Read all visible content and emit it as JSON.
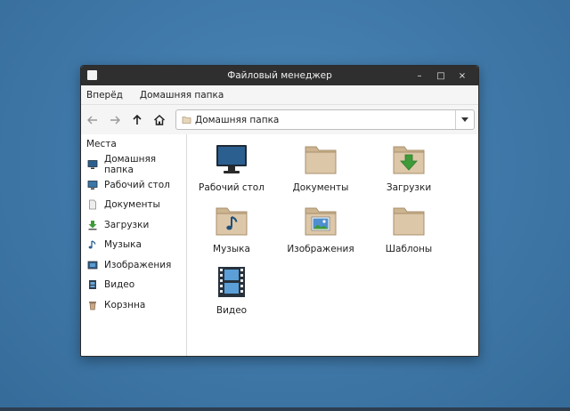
{
  "window": {
    "title": "Файловый менеджер",
    "controls": {
      "minimize": "–",
      "maximize": "□",
      "close": "×"
    }
  },
  "menubar": {
    "items": [
      "Вперёд",
      "Домашняя папка"
    ]
  },
  "toolbar": {
    "location": "Домашняя папка"
  },
  "sidebar": {
    "title": "Места",
    "items": [
      {
        "label": "Домашняя папка",
        "icon": "computer-icon"
      },
      {
        "label": "Рабочий стол",
        "icon": "desktop-icon"
      },
      {
        "label": "Документы",
        "icon": "document-icon"
      },
      {
        "label": "Загрузки",
        "icon": "download-icon"
      },
      {
        "label": "Музыка",
        "icon": "music-note-icon"
      },
      {
        "label": "Изображения",
        "icon": "image-icon"
      },
      {
        "label": "Видео",
        "icon": "video-icon"
      },
      {
        "label": "Корзнна",
        "icon": "trash-icon"
      }
    ]
  },
  "main": {
    "items": [
      {
        "label": "Рабочий стол",
        "icon": "monitor-icon"
      },
      {
        "label": "Документы",
        "icon": "folder-icon"
      },
      {
        "label": "Загрузки",
        "icon": "downloads-folder-icon"
      },
      {
        "label": "Музыка",
        "icon": "music-folder-icon"
      },
      {
        "label": "Изображения",
        "icon": "pictures-folder-icon"
      },
      {
        "label": "Шаблоны",
        "icon": "templates-folder-icon"
      },
      {
        "label": "Видео",
        "icon": "film-icon"
      }
    ]
  },
  "colors": {
    "titlebar": "#2f2f2f",
    "folder": "#d9c4a5",
    "download_green": "#3f9b3a",
    "monitor_screen": "#2b5f8f",
    "desktop_bg": "#4a86b6"
  }
}
